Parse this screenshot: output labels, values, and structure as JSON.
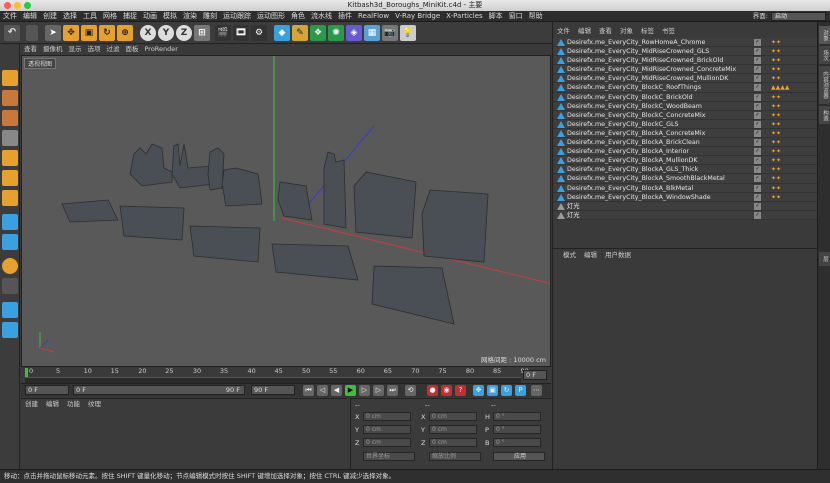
{
  "window": {
    "title": "Kitbash3d_Boroughs_MiniKit.c4d - 主要"
  },
  "menubar": [
    "文件",
    "编辑",
    "创建",
    "选择",
    "工具",
    "网格",
    "捕捉",
    "动画",
    "模拟",
    "渲染",
    "雕刻",
    "运动跟踪",
    "运动图形",
    "角色",
    "流水线",
    "插件",
    "RealFlow",
    "V-Ray Bridge",
    "X-Particles",
    "脚本",
    "窗口",
    "帮助"
  ],
  "layout": {
    "label": "界面:",
    "value": "启动"
  },
  "viewport": {
    "menu": [
      "查看",
      "摄像机",
      "显示",
      "选项",
      "过滤",
      "面板",
      "ProRender"
    ],
    "label": "透视视图",
    "grid_info": "网格间距 : 10000 cm"
  },
  "timeline": {
    "ticks": [
      "0",
      "5",
      "10",
      "15",
      "20",
      "25",
      "30",
      "35",
      "40",
      "45",
      "50",
      "55",
      "60",
      "65",
      "70",
      "75",
      "80",
      "85",
      "90"
    ],
    "end_field": "0 F"
  },
  "transport": {
    "start": "0 F",
    "current": "0 F",
    "range_end": "90 F",
    "end": "90 F"
  },
  "material_manager": {
    "menu": [
      "创建",
      "编辑",
      "功能",
      "纹理"
    ]
  },
  "coordinates": {
    "header_left": "--",
    "header_mid": "--",
    "header_right": "--",
    "rows": [
      {
        "l1": "X",
        "v1": "0 cm",
        "l2": "X",
        "v2": "0 cm",
        "l3": "H",
        "v3": "0 °"
      },
      {
        "l1": "Y",
        "v1": "0 cm",
        "l2": "Y",
        "v2": "0 cm",
        "l3": "P",
        "v3": "0 °"
      },
      {
        "l1": "Z",
        "v1": "0 cm",
        "l2": "Z",
        "v2": "0 cm",
        "l3": "B",
        "v3": "0 °"
      }
    ],
    "mode_select": "世界坐标",
    "scale_select": "缩放比例",
    "apply_label": "应用"
  },
  "object_manager": {
    "menu": [
      "文件",
      "编辑",
      "查看",
      "对象",
      "标签",
      "书签"
    ],
    "objects": [
      "Desirefx.me_EveryCity_RowHomeA_Chrome",
      "Desirefx.me_EveryCity_MidRiseCrowned_GLS",
      "Desirefx.me_EveryCity_MidRiseCrowned_BrickOld",
      "Desirefx.me_EveryCity_MidRiseCrowned_ConcreteMix",
      "Desirefx.me_EveryCity_MidRiseCrowned_MullionDK",
      "Desirefx.me_EveryCity_BlockC_RoofThings",
      "Desirefx.me_EveryCity_BlockC_BrickOld",
      "Desirefx.me_EveryCity_BlockC_WoodBeam",
      "Desirefx.me_EveryCity_BlockC_ConcreteMix",
      "Desirefx.me_EveryCity_BlockC_GLS",
      "Desirefx.me_EveryCity_BlockA_ConcreteMix",
      "Desirefx.me_EveryCity_BlockA_BrickClean",
      "Desirefx.me_EveryCity_BlockA_Interior",
      "Desirefx.me_EveryCity_BlockA_MullionDK",
      "Desirefx.me_EveryCity_BlockA_GLS_Thick",
      "Desirefx.me_EveryCity_BlockA_SmoothBlackMetal",
      "Desirefx.me_EveryCity_BlockA_BlkMetal",
      "Desirefx.me_EveryCity_BlockA_WindowShade",
      "灯光",
      "灯光"
    ]
  },
  "attributes": {
    "menu": [
      "模式",
      "编辑",
      "用户数据"
    ]
  },
  "right_tabs": [
    "对象",
    "场次",
    "内容浏览器",
    "构造",
    "层"
  ],
  "statusbar": "移动：点击并拖动鼠标移动元素。按住 SHIFT 键量化移动；节点编辑模式时按住 SHIFT 键增加选择对象；按住 CTRL 键减少选择对象。",
  "colors": {
    "accent": "#3aa0e0",
    "panel": "#3a3a3a",
    "viewport": "#595959"
  }
}
